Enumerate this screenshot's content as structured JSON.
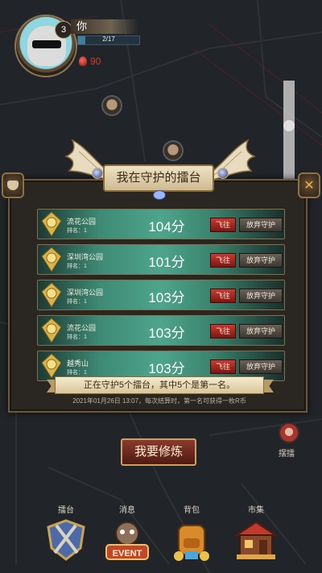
{
  "player": {
    "level": "3",
    "name": "你",
    "xp_text": "2/17",
    "xp_fraction": 0.12,
    "gems": "90"
  },
  "panel": {
    "title": "我在守护的擂台",
    "rows": [
      {
        "name": "流花公园",
        "rank": "排名：1",
        "score": "104分",
        "fly": "飞往",
        "abandon": "放弃守护"
      },
      {
        "name": "深圳湾公园",
        "rank": "排名：1",
        "score": "101分",
        "fly": "飞往",
        "abandon": "放弃守护"
      },
      {
        "name": "深圳湾公园",
        "rank": "排名：1",
        "score": "103分",
        "fly": "飞往",
        "abandon": "放弃守护"
      },
      {
        "name": "流花公园",
        "rank": "排名：1",
        "score": "103分",
        "fly": "飞往",
        "abandon": "放弃守护"
      },
      {
        "name": "越秀山",
        "rank": "排名：1",
        "score": "103分",
        "fly": "飞往",
        "abandon": "放弃守护"
      }
    ],
    "summary": "正在守护5个擂台，其中5个是第一名。",
    "footnote": "2021年01月26日 13:07，每次结算时，第一名可获得一枚R币"
  },
  "side": {
    "challenge_label": "摆擂"
  },
  "cultivate_label": "我要修炼",
  "nav": [
    {
      "label": "擂台",
      "icon": "shield-icon"
    },
    {
      "label": "消息",
      "icon": "event-icon",
      "art_text": "EVENT"
    },
    {
      "label": "背包",
      "icon": "backpack-icon"
    },
    {
      "label": "市集",
      "icon": "market-icon"
    }
  ],
  "colors": {
    "row_green": "#4ea58b",
    "fly_red": "#c73b31",
    "gem_red": "#d13b2b",
    "gold_border": "#81704d"
  }
}
